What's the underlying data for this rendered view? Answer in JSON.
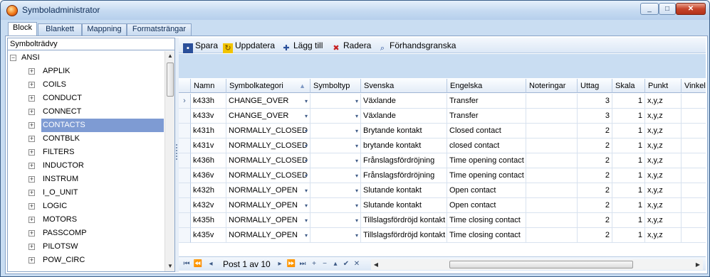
{
  "window": {
    "title": "Symboladministrator",
    "min": "_",
    "max": "□",
    "close": "✕"
  },
  "tabs": [
    "Block",
    "Blankett",
    "Mappning",
    "Formatsträngar"
  ],
  "tree": {
    "header": "Symbolträdvy",
    "root": "ANSI",
    "items": [
      "APPLIK",
      "COILS",
      "CONDUCT",
      "CONNECT",
      "CONTACTS",
      "CONTBLK",
      "FILTERS",
      "INDUCTOR",
      "INSTRUM",
      "I_O_UNIT",
      "LOGIC",
      "MOTORS",
      "PASSCOMP",
      "PILOTSW",
      "POW_CIRC"
    ],
    "selected": "CONTACTS"
  },
  "toolbar": {
    "save": "Spara",
    "update": "Uppdatera",
    "add": "Lägg till",
    "delete": "Radera",
    "preview": "Förhandsgranska"
  },
  "grid": {
    "columns": [
      "Namn",
      "Symbolkategori",
      "Symboltyp",
      "Svenska",
      "Engelska",
      "Noteringar",
      "Uttag",
      "Skala",
      "Punkt",
      "Vinkel"
    ],
    "rows": [
      [
        "k433h",
        "CHANGE_OVER",
        "",
        "Växlande",
        "Transfer",
        "",
        "3",
        "1",
        "x,y,z",
        ""
      ],
      [
        "k433v",
        "CHANGE_OVER",
        "",
        "Växlande",
        "Transfer",
        "",
        "3",
        "1",
        "x,y,z",
        ""
      ],
      [
        "k431h",
        "NORMALLY_CLOSED",
        "",
        "Brytande kontakt",
        "Closed contact",
        "",
        "2",
        "1",
        "x,y,z",
        ""
      ],
      [
        "k431v",
        "NORMALLY_CLOSED",
        "",
        "brytande kontakt",
        "closed contact",
        "",
        "2",
        "1",
        "x,y,z",
        ""
      ],
      [
        "k436h",
        "NORMALLY_CLOSED",
        "",
        "Frånslagsfördröjning",
        "Time opening contact",
        "",
        "2",
        "1",
        "x,y,z",
        ""
      ],
      [
        "k436v",
        "NORMALLY_CLOSED",
        "",
        "Frånslagsfördröjning",
        "Time opening contact",
        "",
        "2",
        "1",
        "x,y,z",
        ""
      ],
      [
        "k432h",
        "NORMALLY_OPEN",
        "",
        "Slutande kontakt",
        "Open contact",
        "",
        "2",
        "1",
        "x,y,z",
        ""
      ],
      [
        "k432v",
        "NORMALLY_OPEN",
        "",
        "Slutande kontakt",
        "Open contact",
        "",
        "2",
        "1",
        "x,y,z",
        ""
      ],
      [
        "k435h",
        "NORMALLY_OPEN",
        "",
        "Tillslagsfördröjd kontakt",
        "Time closing contact",
        "",
        "2",
        "1",
        "x,y,z",
        ""
      ],
      [
        "k435v",
        "NORMALLY_OPEN",
        "",
        "Tillslagsfördröjd kontakt",
        "Time closing contact",
        "",
        "2",
        "1",
        "x,y,z",
        ""
      ]
    ]
  },
  "pager": {
    "text": "Post 1 av 10",
    "first": "⏮",
    "prev_page": "⏪",
    "prev": "◂",
    "next": "▸",
    "next_page": "⏩",
    "last": "⏭",
    "add": "+",
    "remove": "−",
    "up": "▴",
    "confirm": "✔",
    "cancel": "✕"
  },
  "icons": {
    "expand": "+",
    "collapse": "−",
    "sort": "▲",
    "dropdown": "▾",
    "row_indicator": "›",
    "scroll_up": "▲",
    "scroll_down": "▼",
    "scroll_left": "◀",
    "scroll_right": "▶"
  }
}
